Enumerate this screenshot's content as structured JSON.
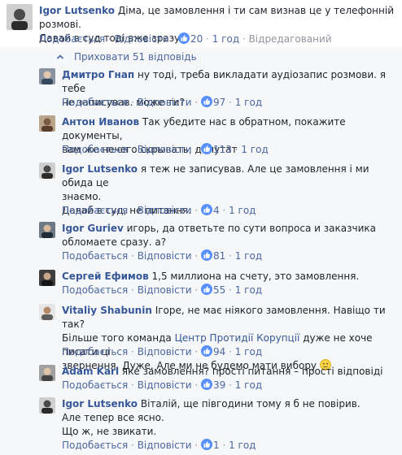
{
  "top_comment": {
    "author": "Igor Lutsenko",
    "text_line1": " Діма, це замовлення і ти сам визнав це у телефонній розмові.",
    "text_line2": "Давай в суд тоді вже зразу?)",
    "like_label": "Подобається",
    "reply_label": "Відповісти",
    "like_count": "20",
    "time": "1 год",
    "edited": "Відредагований"
  },
  "replies_toggle": {
    "label": "Приховати 51 відповідь",
    "icon": "chevron-up-icon"
  },
  "replies": [
    {
      "author": "Дмитро Гнап",
      "lines": [
        " ну тоді, треба викладати аудіозапис розмови. я тебе",
        "не записував. може ти?"
      ],
      "like_label": "Подобається",
      "reply_label": "Відповісти",
      "like_count": "97",
      "time": "1 год"
    },
    {
      "author": "Антон Иванов",
      "lines": [
        " Так убедите нас в обратном, покажите документы,",
        "вам же нечего скрывать, депутат"
      ],
      "like_label": "Подобається",
      "reply_label": "Відповісти",
      "like_count": "113",
      "time": "1 год"
    },
    {
      "author": "Igor Lutsenko",
      "lines": [
        " я теж не записував. Але це замовлення і ми обида це",
        "знаємо.",
        "Давай в суд, не питання."
      ],
      "like_label": "Подобається",
      "reply_label": "Відповісти",
      "like_count": "4",
      "time": "1 год"
    },
    {
      "author": "Igor Guriev",
      "lines": [
        " игорь, да ответьте по сути вопроса и заказчика",
        "обломаете сразу. а?"
      ],
      "like_label": "Подобається",
      "reply_label": "Відповісти",
      "like_count": "81",
      "time": "1 год"
    },
    {
      "author": "Сергей Ефимов",
      "lines": [
        " 1,5 миллиона на счету, это замовлення."
      ],
      "like_label": "Подобається",
      "reply_label": "Відповісти",
      "like_count": "55",
      "time": "1 год"
    },
    {
      "author": "Vitaliy Shabunin",
      "line1": " Ігоре, не має ніякого замовлення. Навіщо ти так?",
      "line2_pre": "Більше того команда ",
      "line2_link": "Центр Протидії Корупції",
      "line2_post": " дуже не хоче писати ці",
      "line3": "звернення. Дуже. Але ми не будемо мати вибору",
      "like_label": "Подобається",
      "reply_label": "Відповісти",
      "like_count": "94",
      "time": "1 год"
    },
    {
      "author": "Adam Karl",
      "lines": [
        " яке замовлення? прості питання – прості відповіді"
      ],
      "like_label": "Подобається",
      "reply_label": "Відповісти",
      "like_count": "39",
      "time": "1 год"
    },
    {
      "author": "Igor Lutsenko",
      "lines": [
        " Віталій, ще півгодини тому я б не повірив.",
        "Але тепер все ясно.",
        "Що ж, не звикати."
      ],
      "like_label": "Подобається",
      "reply_label": "Відповісти",
      "like_count": "1",
      "time": "1 год"
    }
  ],
  "separator": " · ",
  "colors": {
    "link": "#365899",
    "action": "#4b67a1",
    "muted": "#90949c",
    "background": "#f6f7f9"
  }
}
